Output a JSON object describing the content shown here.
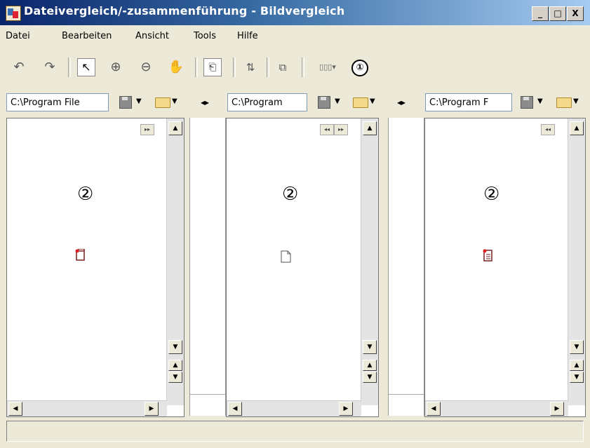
{
  "window": {
    "title": "Dateivergleich/-zusammenführung - Bildvergleich",
    "minimize": "_",
    "maximize": "□",
    "close": "X"
  },
  "menu": [
    {
      "label": "Datei"
    },
    {
      "label": "Bearbeiten"
    },
    {
      "label": "Ansicht"
    },
    {
      "label": "Tools"
    },
    {
      "label": "Hilfe"
    }
  ],
  "toolbar": {
    "callout": "①",
    "icons": [
      "undo-icon",
      "redo-icon",
      "pointer-icon",
      "zoom-in-icon",
      "zoom-out-icon",
      "pan-hand-icon",
      "two-panes-icon",
      "compare-icon",
      "swap-icon",
      "more-icon"
    ]
  },
  "panes": [
    {
      "path": "C:\\Program File",
      "callout": "②"
    },
    {
      "path": "C:\\Program",
      "callout": "②"
    },
    {
      "path": "C:\\Program F",
      "callout": "②"
    }
  ],
  "status": ""
}
